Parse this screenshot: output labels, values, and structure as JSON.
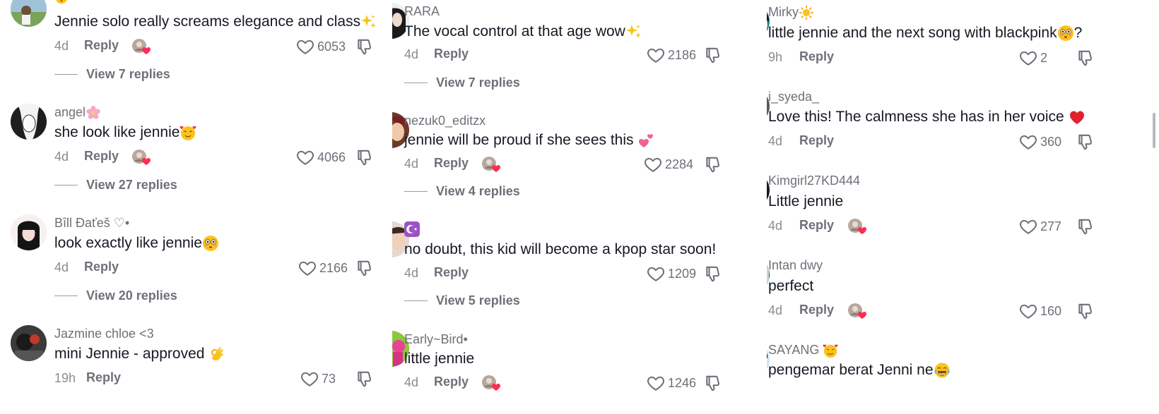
{
  "panels": [
    {
      "comments": [
        {
          "username": "",
          "text": "Jennie solo really screams elegance and class",
          "time": "4d",
          "reply": "Reply",
          "likes": "6053",
          "creator_liked": true,
          "view_replies": "View 7 replies"
        },
        {
          "username": "angel",
          "text": "she look like jennie",
          "time": "4d",
          "reply": "Reply",
          "likes": "4066",
          "creator_liked": true,
          "view_replies": "View 27 replies"
        },
        {
          "username": "Bîll Ðaťeš ♡•",
          "text": "look exactly like jennie",
          "time": "4d",
          "reply": "Reply",
          "likes": "2166",
          "creator_liked": false,
          "view_replies": "View 20 replies"
        },
        {
          "username": "Jazmine chloe <3",
          "text": "mini Jennie - approved",
          "time": "19h",
          "reply": "Reply",
          "likes": "73",
          "creator_liked": false,
          "view_replies": ""
        }
      ]
    },
    {
      "comments": [
        {
          "username": "RARA",
          "text": "The vocal control at that age wow",
          "time": "4d",
          "reply": "Reply",
          "likes": "2186",
          "creator_liked": false,
          "view_replies": "View 7 replies"
        },
        {
          "username": "nezuk0_editzx",
          "text": "jennie will be proud if she sees this",
          "time": "4d",
          "reply": "Reply",
          "likes": "2284",
          "creator_liked": true,
          "view_replies": "View 4 replies"
        },
        {
          "username": "",
          "text": "no doubt, this kid will become a kpop star soon!",
          "time": "4d",
          "reply": "Reply",
          "likes": "1209",
          "creator_liked": false,
          "view_replies": "View 5 replies"
        },
        {
          "username": "Early~Bird•",
          "text": "little jennie",
          "time": "4d",
          "reply": "Reply",
          "likes": "1246",
          "creator_liked": true,
          "view_replies": ""
        }
      ]
    },
    {
      "comments": [
        {
          "username": "Mirky",
          "text": "little jennie and the next song with blackpink",
          "text_suffix": "?",
          "time": "9h",
          "reply": "Reply",
          "likes": "2",
          "creator_liked": false,
          "view_replies": ""
        },
        {
          "username": "i_syeda_",
          "text": "Love this! The calmness she has in her voice",
          "time": "4d",
          "reply": "Reply",
          "likes": "360",
          "creator_liked": false,
          "view_replies": ""
        },
        {
          "username": "Kimgirl27KD444",
          "text": "Little jennie",
          "time": "4d",
          "reply": "Reply",
          "likes": "277",
          "creator_liked": true,
          "view_replies": ""
        },
        {
          "username": "Intan dwy",
          "text": "perfect",
          "time": "4d",
          "reply": "Reply",
          "likes": "160",
          "creator_liked": true,
          "view_replies": ""
        },
        {
          "username": "SAYANG",
          "text": "pengemar berat Jenni ne",
          "time": "",
          "reply": "",
          "likes": "",
          "creator_liked": false,
          "view_replies": ""
        }
      ]
    }
  ],
  "colors": {
    "text": "#161823",
    "muted": "#6f7079",
    "like_heart": "#fe2c55"
  },
  "icons": {
    "sparkles": "sparkles-icon",
    "blossom": "cherry-blossom-icon",
    "smiling_hearts": "smiling-face-with-hearts-icon",
    "flushed": "flushed-face-icon",
    "ok_hand": "ok-hand-icon",
    "two_hearts": "two-hearts-icon",
    "star_crescent": "star-and-crescent-icon",
    "sun": "sun-icon",
    "red_heart": "red-heart-icon",
    "tears_joy": "face-with-tears-of-joy-icon"
  }
}
